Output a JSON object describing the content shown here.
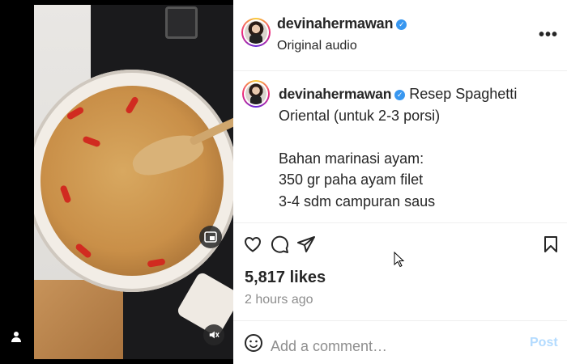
{
  "post": {
    "username": "devinahermawan",
    "audio": "Original audio",
    "caption": "Resep Spaghetti Oriental (untuk 2-3 porsi)\n\nBahan marinasi ayam:\n350 gr paha ayam filet\n3-4 sdm campuran saus",
    "likes": "5,817 likes",
    "time": "2 hours ago"
  },
  "comment": {
    "placeholder": "Add a comment…",
    "post_label": "Post"
  },
  "icons": {
    "verified": "verified-badge",
    "more": "more-options-icon",
    "like": "heart-icon",
    "comment": "comment-icon",
    "share": "share-icon",
    "save": "bookmark-icon",
    "emoji": "emoji-icon",
    "pip": "picture-in-picture-icon",
    "mute": "speaker-muted-icon",
    "tag": "user-tag-icon"
  },
  "colors": {
    "accent": "#3897f0",
    "post_disabled": "#b3dbff",
    "text": "#262626",
    "muted": "#8e8e8e"
  }
}
